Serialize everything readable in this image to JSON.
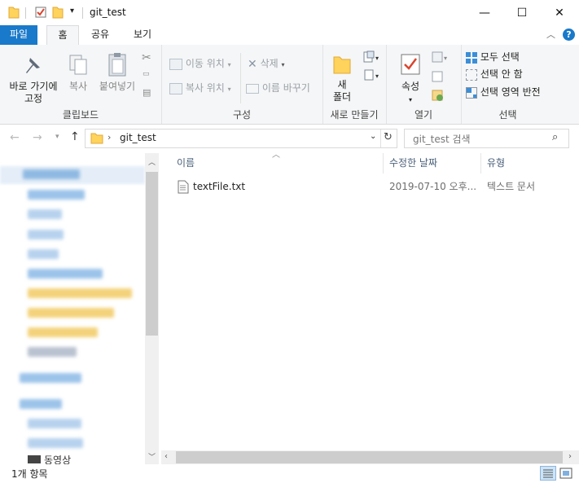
{
  "window": {
    "title": "git_test",
    "controls": {
      "minimize": "—",
      "maximize": "☐",
      "close": "✕"
    }
  },
  "ribbon_tabs": [
    "파일",
    "홈",
    "공유",
    "보기"
  ],
  "ribbon": {
    "clipboard": {
      "label": "클립보드",
      "pin_line1": "바로 가기에",
      "pin_line2": "고정",
      "copy": "복사",
      "paste": "붙여넣기"
    },
    "organize": {
      "label": "구성",
      "move_to": "이동 위치",
      "copy_to": "복사 위치",
      "delete": "삭제",
      "rename": "이름 바꾸기"
    },
    "new": {
      "label": "새로 만들기",
      "new_folder_line1": "새",
      "new_folder_line2": "폴더"
    },
    "open": {
      "label": "열기",
      "properties": "속성"
    },
    "select": {
      "label": "선택",
      "select_all": "모두 선택",
      "select_none": "선택 안 함",
      "invert": "선택 영역 반전"
    }
  },
  "address": {
    "path": "git_test",
    "search_placeholder": "git_test 검색"
  },
  "nav_pane": {
    "last_item": "동영상"
  },
  "columns": {
    "name": "이름",
    "date": "수정한 날짜",
    "type": "유형"
  },
  "files": [
    {
      "name": "textFile.txt",
      "date": "2019-07-10 오후...",
      "type": "텍스트 문서"
    }
  ],
  "status": {
    "count": "1개 항목"
  },
  "colors": {
    "file_tab": "#1979ca",
    "folder": "#ffd35c",
    "ribbon_bg": "#f5f6f7",
    "header_text": "#4c607a"
  }
}
